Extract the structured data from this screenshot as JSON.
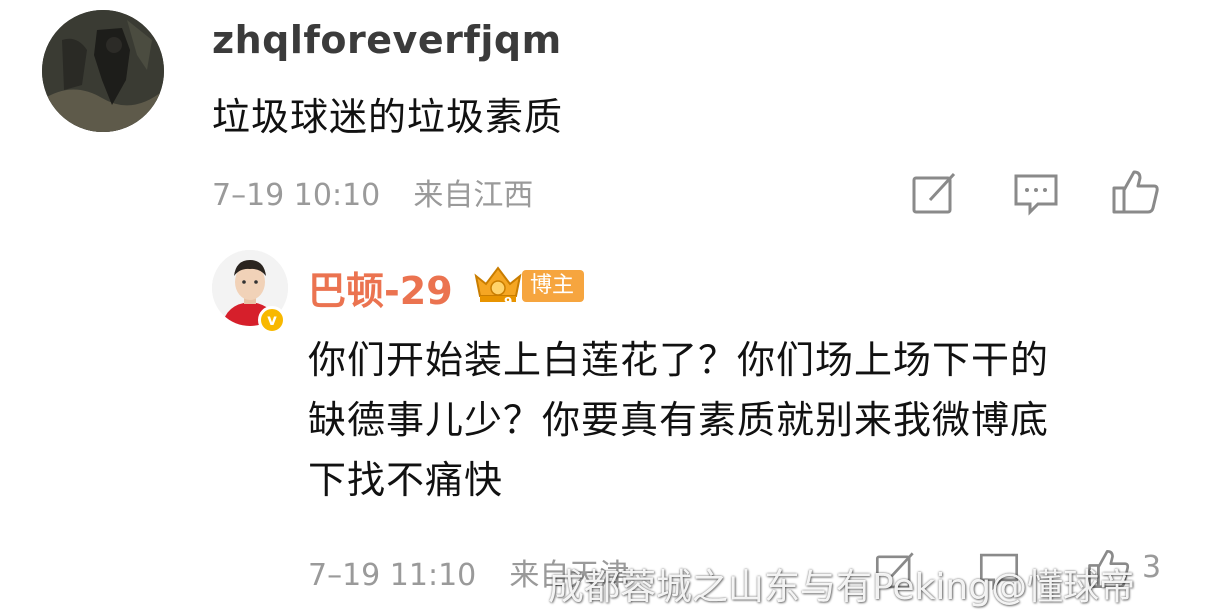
{
  "main_comment": {
    "username": "zhqlforeverfjqm",
    "text": "垃圾球迷的垃圾素质",
    "time": "7–19 10:10",
    "location": "来自江西",
    "actions": [
      "edit-icon",
      "comment-icon",
      "like-icon"
    ]
  },
  "reply": {
    "username": "巴顿-29",
    "badge": "博主",
    "verified_mark": "v",
    "text_lines": [
      "你们开始装上白莲花了？你们场上场下干的",
      "缺德事儿少？你要真有素质就别来我微博底",
      "下找不痛快"
    ],
    "time": "7–19 11:10",
    "location": "来自天津",
    "like_count": "3",
    "actions": [
      "edit-icon",
      "comment-icon",
      "like-icon"
    ]
  },
  "watermark": "成都蓉城之山东与有Peking@懂球帝",
  "colors": {
    "reply_username": "#eb7350",
    "badge_bg": "#f6a53f",
    "meta_text": "#9a9a9a",
    "verified": "#f8b800"
  }
}
